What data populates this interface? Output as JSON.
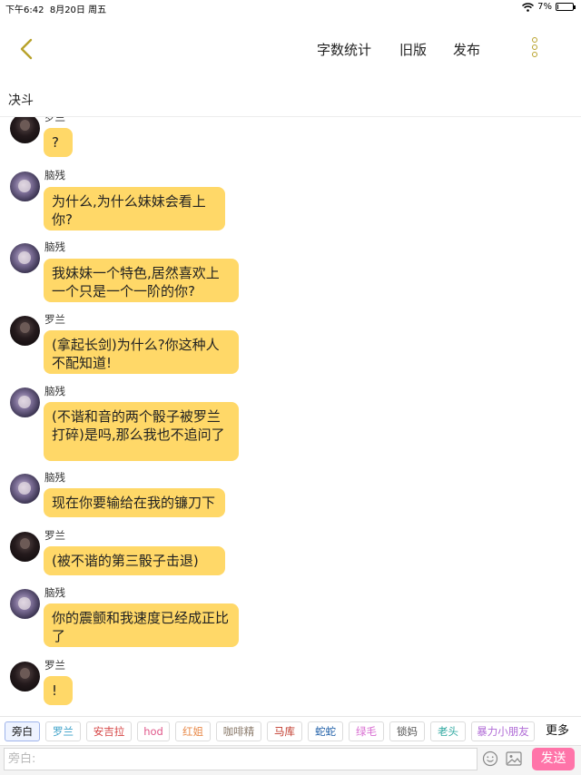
{
  "status_bar": {
    "time": "下午6:42",
    "date": "8月20日 周五",
    "battery": "7%",
    "battery_level": 0.07
  },
  "header": {
    "stats_label": "字数统计",
    "old_version_label": "旧版",
    "publish_label": "发布",
    "accent_color": "#b8a22a"
  },
  "title": "决斗",
  "messages": [
    {
      "sender": "罗兰",
      "avatar": "luolan",
      "text": "?"
    },
    {
      "sender": "脑残",
      "avatar": "naocan",
      "text": "为什么,为什么妹妹会看上你?"
    },
    {
      "sender": "脑残",
      "avatar": "naocan",
      "text": "我妹妹一个特色,居然喜欢上一个只是一个一阶的你?"
    },
    {
      "sender": "罗兰",
      "avatar": "luolan",
      "text": "(拿起长剑)为什么?你这种人不配知道!"
    },
    {
      "sender": "脑残",
      "avatar": "naocan",
      "text": "(不谐和音的两个骰子被罗兰打碎)是吗,那么我也不追问了"
    },
    {
      "sender": "脑残",
      "avatar": "naocan",
      "text": "现在你要输给在我的镰刀下"
    },
    {
      "sender": "罗兰",
      "avatar": "luolan",
      "text": "(被不谐的第三骰子击退)"
    },
    {
      "sender": "脑残",
      "avatar": "naocan",
      "text": "你的震颤和我速度已经成正比了"
    },
    {
      "sender": "罗兰",
      "avatar": "luolan",
      "text": "!"
    }
  ],
  "characters": [
    {
      "label": "旁白",
      "color": "#111111",
      "active": true
    },
    {
      "label": "罗兰",
      "color": "#3aa0c8"
    },
    {
      "label": "安吉拉",
      "color": "#d64545"
    },
    {
      "label": "hod",
      "color": "#e0588a"
    },
    {
      "label": "红姐",
      "color": "#e88a4a"
    },
    {
      "label": "咖啡精",
      "color": "#8a7a6a"
    },
    {
      "label": "马库",
      "color": "#c0392b"
    },
    {
      "label": "蛇蛇",
      "color": "#1f5fa8"
    },
    {
      "label": "绿毛",
      "color": "#d96fd2"
    },
    {
      "label": "锁妈",
      "color": "#555555"
    },
    {
      "label": "老头",
      "color": "#2fa8a0"
    },
    {
      "label": "暴力小朋友",
      "color": "#b06bd6"
    }
  ],
  "more_label": "更多",
  "input": {
    "placeholder": "旁白:",
    "value": ""
  },
  "send_label": "发送",
  "send_color": "#ff74a9",
  "bubble_color": "#ffd868"
}
